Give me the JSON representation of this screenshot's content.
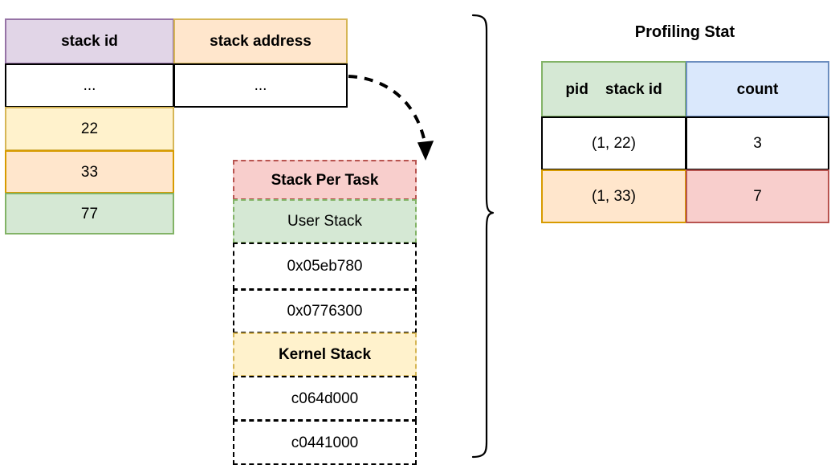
{
  "stack_id_table": {
    "headers": [
      "stack id",
      "stack address"
    ],
    "rows": [
      {
        "stack_id": "...",
        "stack_address": "..."
      },
      {
        "stack_id": "22",
        "stack_address": ""
      },
      {
        "stack_id": "33",
        "stack_address": ""
      },
      {
        "stack_id": "77",
        "stack_address": ""
      }
    ],
    "colors": {
      "header_id_fill": "#e1d5e7",
      "header_id_border": "#9673a6",
      "header_addr_fill": "#ffe6cc",
      "header_addr_border": "#d6b656",
      "row_22_fill": "#fff2cc",
      "row_33_fill": "#ffe6cc",
      "row_77_fill": "#d5e8d4"
    }
  },
  "stack_per_task": {
    "title": "Stack Per Task",
    "user_stack_label": "User Stack",
    "kernel_stack_label": "Kernel Stack",
    "user_addresses": [
      "0x05eb780",
      "0x0776300"
    ],
    "kernel_addresses": [
      "c064d000",
      "c0441000"
    ],
    "colors": {
      "title_fill": "#f8cecc",
      "title_border": "#b85450",
      "user_fill": "#d5e8d4",
      "user_border": "#82b366",
      "kernel_fill": "#fff2cc",
      "kernel_border": "#d6b656"
    }
  },
  "profiling_stat": {
    "title": "Profiling Stat",
    "headers": [
      "pid    stack id",
      "count"
    ],
    "rows": [
      {
        "key": "(1, 22)",
        "count": "3"
      },
      {
        "key": "(1, 33)",
        "count": "7"
      }
    ],
    "colors": {
      "header_key_fill": "#d5e8d4",
      "header_key_border": "#82b366",
      "header_count_fill": "#dae8fc",
      "header_count_border": "#6c8ebf",
      "row2_key_fill": "#ffe6cc",
      "row2_key_border": "#d79b00",
      "row2_count_fill": "#f8cecc",
      "row2_count_border": "#b85450"
    }
  },
  "connectors": {
    "arrow": {
      "name": "dashed-curved-arrow",
      "from": "stack address row",
      "to": "Stack Per Task"
    },
    "brace": {
      "name": "right-curly-brace",
      "orientation": "right-pointing"
    }
  }
}
